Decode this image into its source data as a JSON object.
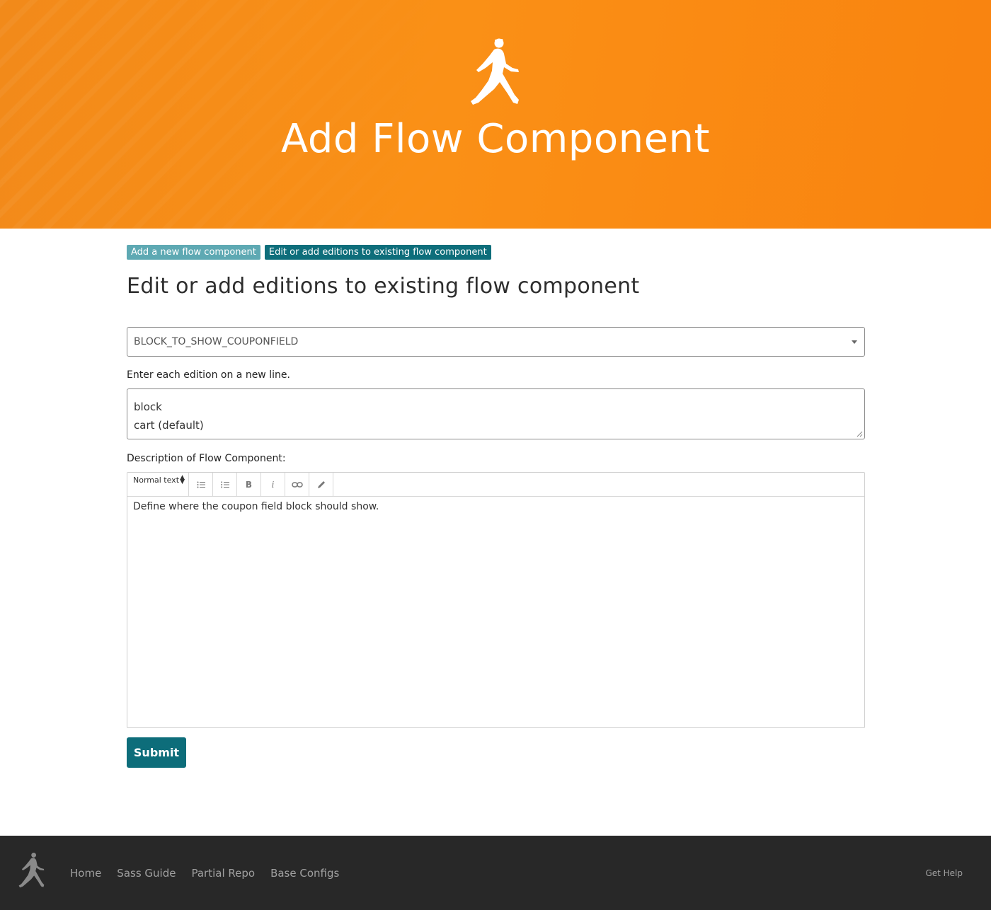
{
  "hero": {
    "title": "Add Flow Component",
    "logo_icon": "walking-man-icon",
    "accent_color": "#f7891a"
  },
  "tabs": [
    {
      "label": "Add a new flow component",
      "active": false
    },
    {
      "label": "Edit or add editions to existing flow component",
      "active": true
    }
  ],
  "section": {
    "title": "Edit or add editions to existing flow component"
  },
  "component_select": {
    "selected": "BLOCK_TO_SHOW_COUPONFIELD"
  },
  "editions": {
    "label": "Enter each edition on a new line.",
    "lines": [
      "block",
      "cart (default)"
    ]
  },
  "description": {
    "label": "Description of Flow Component:",
    "format_select": "Normal text",
    "toolbar_icons": [
      "unordered-list-icon",
      "ordered-list-icon",
      "bold-icon",
      "italic-icon",
      "link-icon",
      "pencil-icon"
    ],
    "body": "Define where the coupon field block should show."
  },
  "submit": {
    "label": "Submit",
    "color": "#0d6d7a"
  },
  "footer": {
    "nav": [
      "Home",
      "Sass Guide",
      "Partial Repo",
      "Base Configs"
    ],
    "help": "Get Help"
  }
}
